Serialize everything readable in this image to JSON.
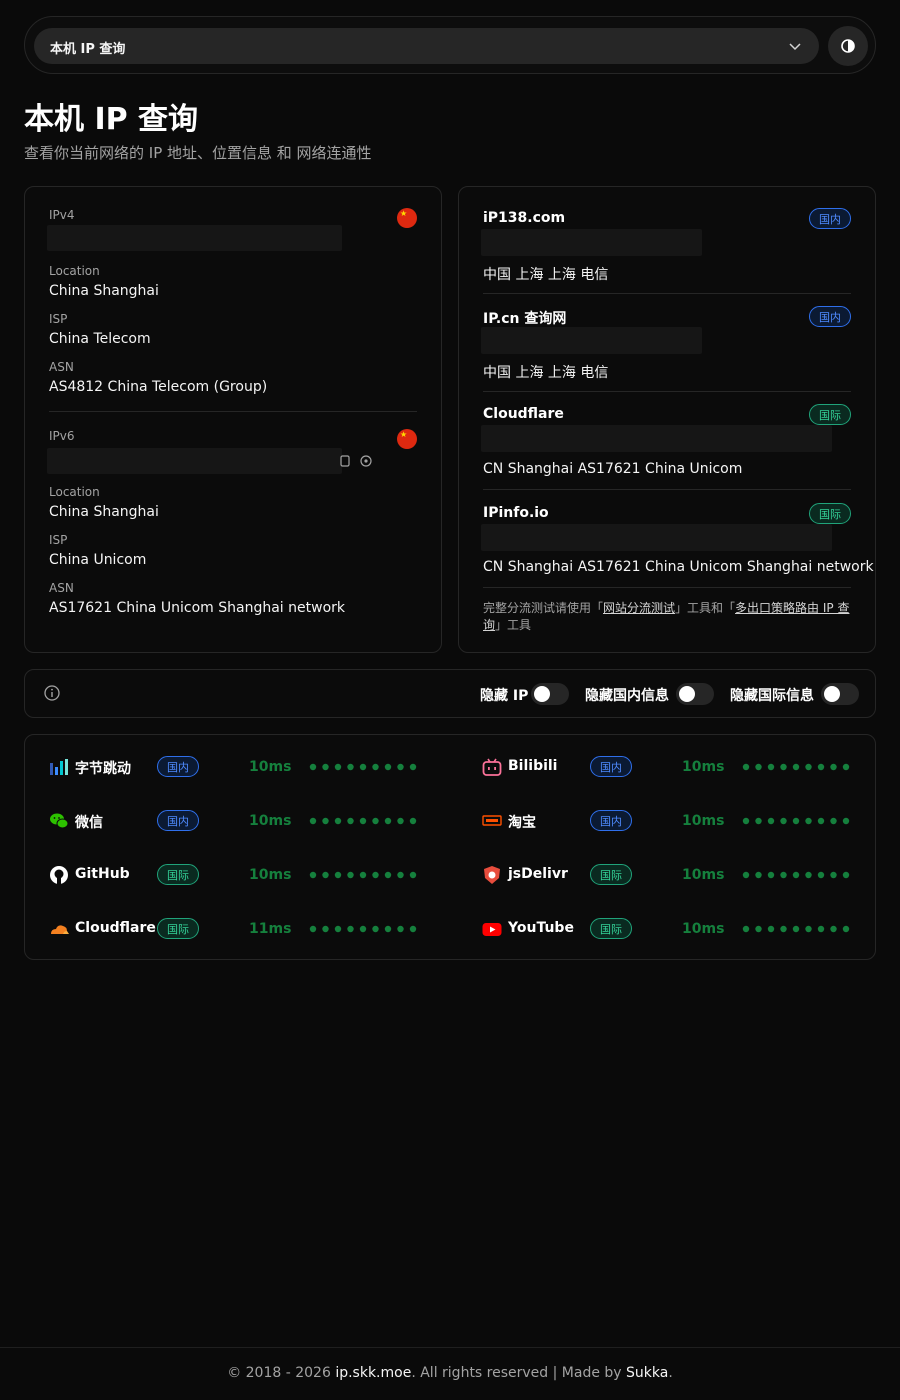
{
  "header": {
    "select_value": "本机 IP 查询"
  },
  "page": {
    "title": "本机 IP 查询",
    "subtitle": "查看你当前网络的 IP 地址、位置信息 和 网络连通性"
  },
  "ipv4": {
    "label": "IPv4",
    "location_label": "Location",
    "location": "China Shanghai",
    "isp_label": "ISP",
    "isp": "China Telecom",
    "asn_label": "ASN",
    "asn": "AS4812 China Telecom (Group)"
  },
  "ipv6": {
    "label": "IPv6",
    "location_label": "Location",
    "location": "China Shanghai",
    "isp_label": "ISP",
    "isp": "China Unicom",
    "asn_label": "ASN",
    "asn": "AS17621 China Unicom Shanghai network"
  },
  "sources": [
    {
      "name": "iP138.com",
      "badge": "国内",
      "result": "中国 上海 上海 电信"
    },
    {
      "name": "IP.cn 查询网",
      "badge": "国内",
      "result": "中国 上海 上海 电信"
    },
    {
      "name": "Cloudflare",
      "badge": "国际",
      "result": "CN Shanghai AS17621 China Unicom"
    },
    {
      "name": "IPinfo.io",
      "badge": "国际",
      "result": "CN Shanghai AS17621 China Unicom Shanghai network"
    }
  ],
  "note": {
    "prefix": "完整分流测试请使用「",
    "link1": "网站分流测试",
    "middle": "」工具和「",
    "link2": "多出口策略路由 IP 查询",
    "suffix": "」工具"
  },
  "toggles": {
    "hide_ip": "隐藏 IP",
    "hide_domestic": "隐藏国内信息",
    "hide_intl": "隐藏国际信息"
  },
  "connectivity": [
    {
      "name": "字节跳动",
      "badge": "国内",
      "latency": "10ms",
      "icon": "bytedance-icon"
    },
    {
      "name": "Bilibili",
      "badge": "国内",
      "latency": "10ms",
      "icon": "bilibili-icon"
    },
    {
      "name": "微信",
      "badge": "国内",
      "latency": "10ms",
      "icon": "wechat-icon"
    },
    {
      "name": "淘宝",
      "badge": "国内",
      "latency": "10ms",
      "icon": "taobao-icon"
    },
    {
      "name": "GitHub",
      "badge": "国际",
      "latency": "10ms",
      "icon": "github-icon"
    },
    {
      "name": "jsDelivr",
      "badge": "国际",
      "latency": "10ms",
      "icon": "jsdelivr-icon"
    },
    {
      "name": "Cloudflare",
      "badge": "国际",
      "latency": "11ms",
      "icon": "cloudflare-icon"
    },
    {
      "name": "YouTube",
      "badge": "国际",
      "latency": "10ms",
      "icon": "youtube-icon"
    }
  ],
  "footer": {
    "prefix": "© 2018 - 2026 ",
    "site": "ip.skk.moe",
    "middle": ". All rights reserved | Made by ",
    "author": "Sukka",
    "suffix": "."
  },
  "colors": {
    "background": "#0a0a0a",
    "domestic": "#4f8bff",
    "international": "#34d399",
    "latency_green": "#15803d",
    "flag_red": "#de2910"
  }
}
